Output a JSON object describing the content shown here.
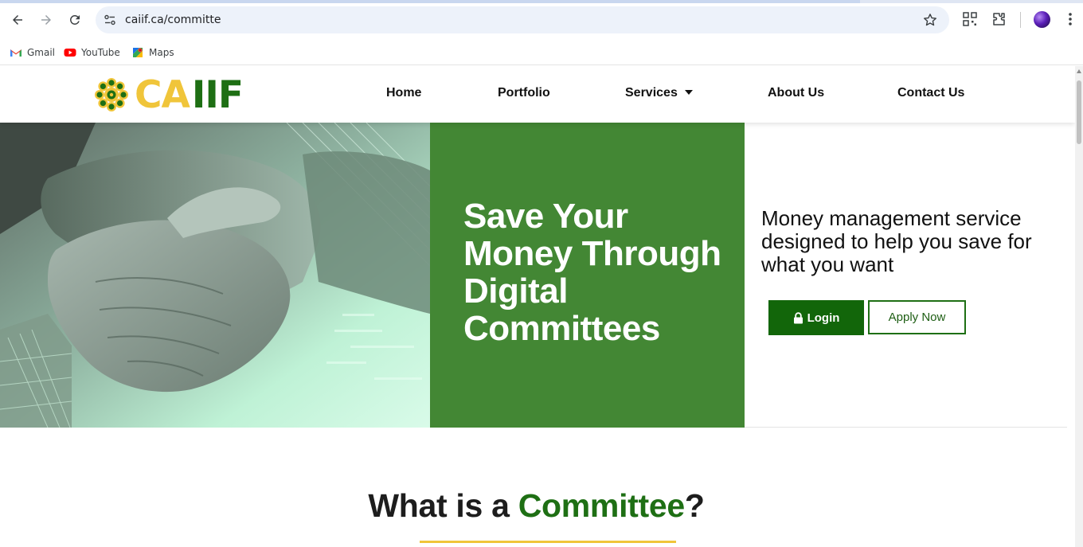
{
  "browser": {
    "url": "caiif.ca/committe",
    "bookmarks": [
      {
        "label": "Gmail",
        "icon": "gmail-icon"
      },
      {
        "label": "YouTube",
        "icon": "youtube-icon"
      },
      {
        "label": "Maps",
        "icon": "maps-icon"
      }
    ]
  },
  "site": {
    "logo": {
      "part1": "CA",
      "part2": "IIF"
    },
    "nav": {
      "home": "Home",
      "portfolio": "Portfolio",
      "services": "Services",
      "about": "About Us",
      "contact": "Contact Us"
    },
    "hero": {
      "title": "Save Your Money Through Digital Committees",
      "subtitle": "Money management service designed to help you save for what you want",
      "login_label": "Login",
      "apply_label": "Apply Now"
    },
    "section": {
      "title_prefix": "What is a ",
      "title_highlight": "Committee",
      "title_suffix": "?"
    }
  },
  "colors": {
    "brand_green": "#1e6f14",
    "hero_green": "#438734",
    "brand_gold": "#f0c53a",
    "login_bg": "#12660a"
  }
}
